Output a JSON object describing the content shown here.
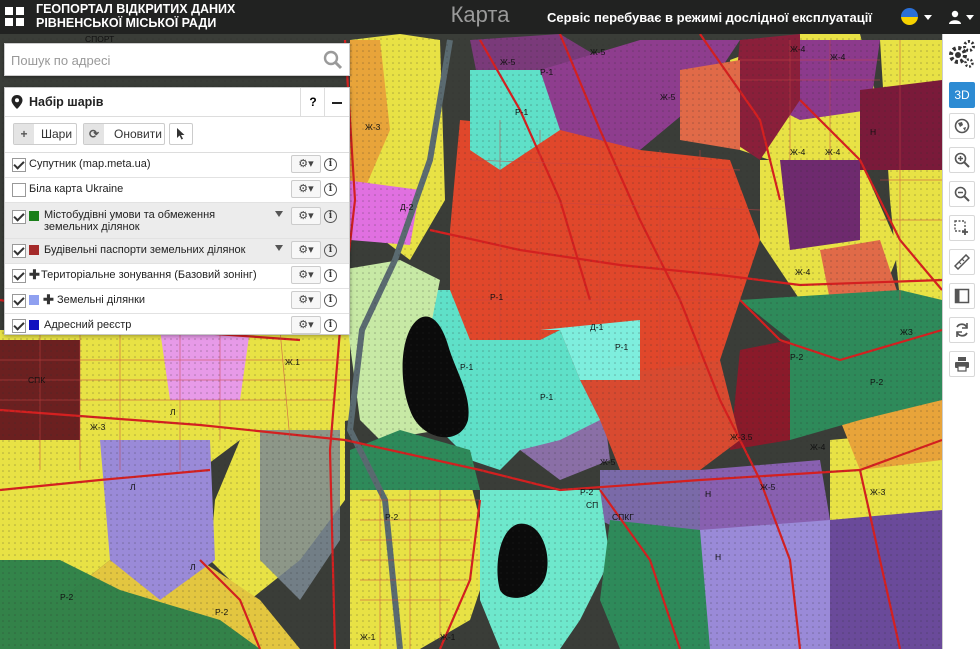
{
  "header": {
    "brand_line1": "ГЕОПОРТАЛ ВІДКРИТИХ ДАНИХ",
    "brand_line2": "РІВНЕНСЬКОЇ МІСЬКОЇ РАДИ",
    "center_title": "Карта",
    "mode_text": "Сервіс перебуває в режимі дослідної експлуатації",
    "flag_colors": [
      "#2a6fd6",
      "#f6d200"
    ]
  },
  "search": {
    "placeholder": "Пошук по адресі"
  },
  "layers_panel": {
    "title": "Набір шарів",
    "help_label": "?",
    "toolbar": {
      "add_label": "Шари",
      "refresh_label": "Оновити"
    },
    "gear_label": "⚙▾",
    "info_label": "i",
    "layers": [
      {
        "name": "Супутник (map.meta.ua)",
        "checked": true
      },
      {
        "name": "Біла карта Ukraine",
        "checked": false
      },
      {
        "name": "Містобудівні умови та обмеження земельних ділянок",
        "checked": true,
        "color": "#1a7f1a"
      },
      {
        "name": "Будівельні паспорти земельних ділянок",
        "checked": true,
        "color": "#a52a2a"
      },
      {
        "name": "Територіальне зонування (Базовий зонінг)",
        "checked": true
      },
      {
        "name": "Земельні ділянки",
        "checked": true,
        "color": "#8fa0f0"
      },
      {
        "name": "Адресний реєстр",
        "checked": true,
        "color": "#1010c0"
      }
    ]
  },
  "right_toolbar": {
    "three_d_label": "3D"
  },
  "map": {
    "zone_labels": [
      "СПОРТ",
      "Ж-5",
      "Ж-3",
      "Ж-4",
      "Р-1",
      "Р-2",
      "Д-1",
      "Д-2",
      "Ж-1",
      "Ж.1",
      "Л",
      "СПК",
      "СПКГ",
      "СП",
      "Н",
      "Ж-3.5",
      "ЖЗ"
    ]
  }
}
